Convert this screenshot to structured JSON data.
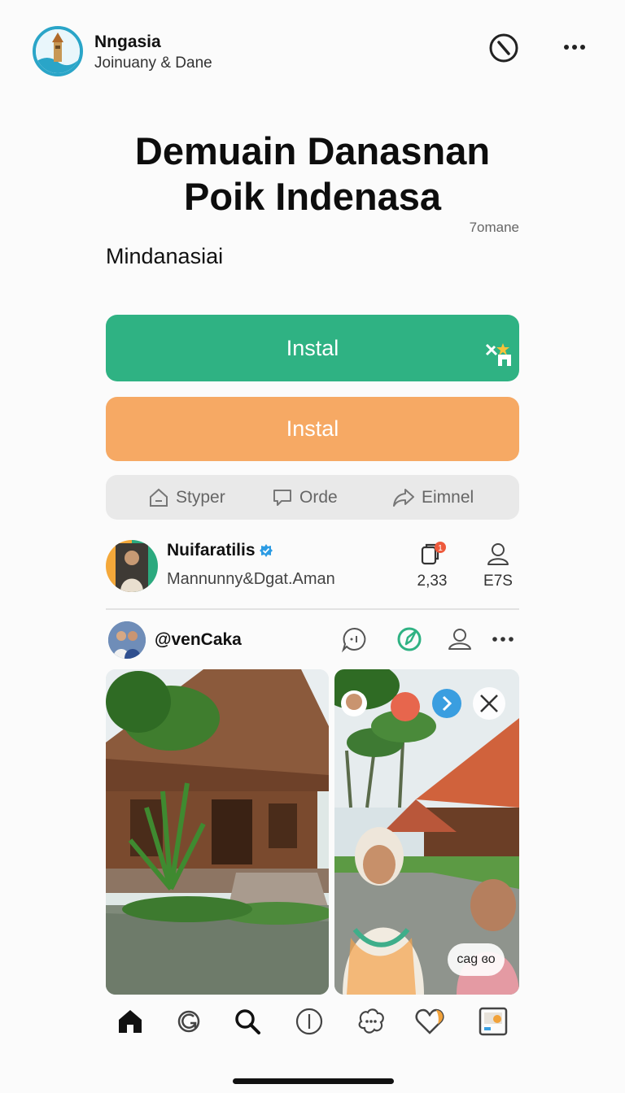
{
  "header": {
    "app_name": "Nngasia",
    "subtitle": "Joinuany & Dane"
  },
  "title_line1": "Demuain Danasnan",
  "title_line2": "Poik Indenasa",
  "meta_label": "7omane",
  "section_label": "Mindanasiai",
  "buttons": {
    "install_primary": "Instal",
    "install_secondary": "Instal"
  },
  "actions": [
    {
      "label": "Styper",
      "icon": "home-outline-icon"
    },
    {
      "label": "Orde",
      "icon": "chat-bubble-icon"
    },
    {
      "label": "Eimnel",
      "icon": "share-arrow-icon"
    }
  ],
  "profile": {
    "name": "Nuifaratilis",
    "verified": true,
    "handle": "Mannunny&Dgat.Aman",
    "stats": [
      {
        "value": "2,33",
        "icon": "copy-icon",
        "badge": "1"
      },
      {
        "value": "E7S",
        "icon": "person-icon"
      }
    ]
  },
  "post": {
    "username": "@venCaka",
    "caption_chip": "cag ɞo",
    "action_icons": [
      "comment-icon",
      "compass-icon",
      "person-icon",
      "more-icon"
    ]
  },
  "nav_icons": [
    "home-icon",
    "refresh-icon",
    "search-icon",
    "info-icon",
    "community-icon",
    "heart-icon",
    "gallery-icon"
  ],
  "colors": {
    "green": "#2fb283",
    "orange": "#f6a964",
    "accent_blue": "#2aa5c8"
  }
}
